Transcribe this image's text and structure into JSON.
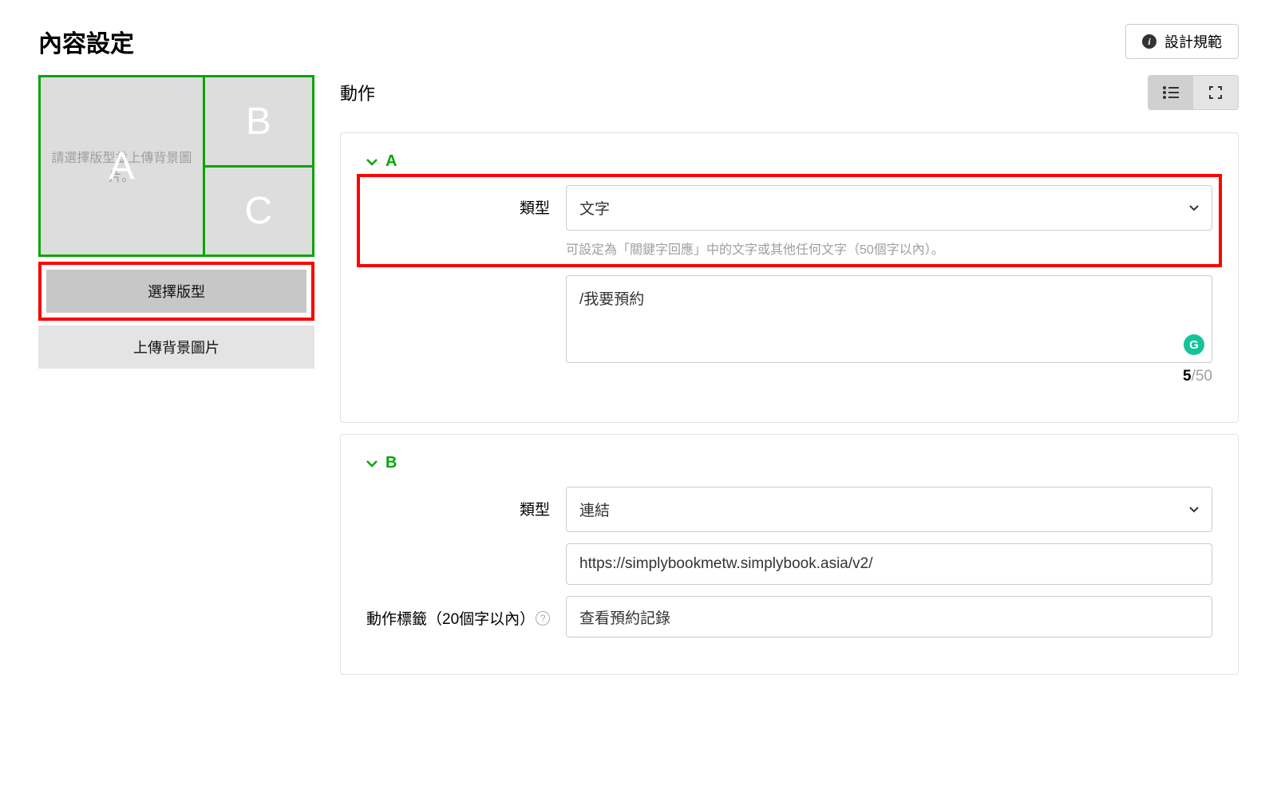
{
  "header": {
    "title": "內容設定",
    "design_button": "設計規範"
  },
  "preview": {
    "hint": "請選擇版型並上傳背景圖片。",
    "areas": {
      "a": "A",
      "b": "B",
      "c": "C"
    }
  },
  "left_buttons": {
    "choose_layout": "選擇版型",
    "upload_bg": "上傳背景圖片"
  },
  "actions": {
    "title": "動作",
    "a": {
      "letter": "A",
      "type_label": "類型",
      "type_value": "文字",
      "type_helper": "可設定為「關鍵字回應」中的文字或其他任何文字（50個字以內）。",
      "text_value": "/我要預約",
      "char_current": "5",
      "char_max": "/50"
    },
    "b": {
      "letter": "B",
      "type_label": "類型",
      "type_value": "連結",
      "url_value": "https://simplybookmetw.simplybook.asia/v2/",
      "action_label_label": "動作標籤（20個字以內）",
      "action_label_value": "查看預約記錄"
    }
  }
}
